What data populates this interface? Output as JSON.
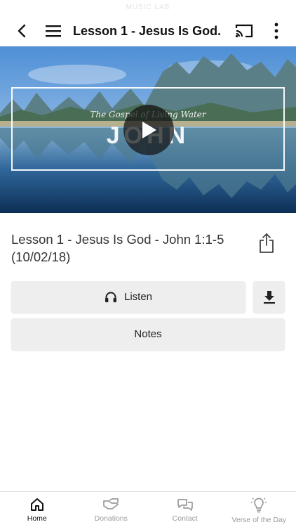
{
  "status_bar": {
    "text": "MUSIC LAB"
  },
  "app_bar": {
    "title": "Lesson 1 - Jesus Is God...",
    "icons": [
      "back-arrow-icon",
      "hamburger-menu-icon",
      "cast-icon",
      "more-vertical-icon"
    ]
  },
  "hero": {
    "subtitle": "The Gospel of Living Water",
    "word": "JOHN",
    "icon": "play-icon"
  },
  "lesson": {
    "title": "Lesson 1 - Jesus Is God - John 1:1-5 (10/02/18)",
    "share_icon": "share-icon"
  },
  "actions": {
    "listen_label": "Listen",
    "listen_icon": "headphones-icon",
    "download_icon": "download-icon",
    "notes_label": "Notes"
  },
  "tabs": [
    {
      "label": "Home",
      "icon": "home-icon",
      "active": true
    },
    {
      "label": "Donations",
      "icon": "donation-hand-icon",
      "active": false
    },
    {
      "label": "Contact",
      "icon": "chat-bubbles-icon",
      "active": false
    },
    {
      "label": "Verse of the Day",
      "icon": "lightbulb-icon",
      "active": false
    }
  ],
  "colors": {
    "active_tab": "#111111",
    "inactive_tab": "#9a9a9a",
    "button_bg": "#eeeeee"
  }
}
